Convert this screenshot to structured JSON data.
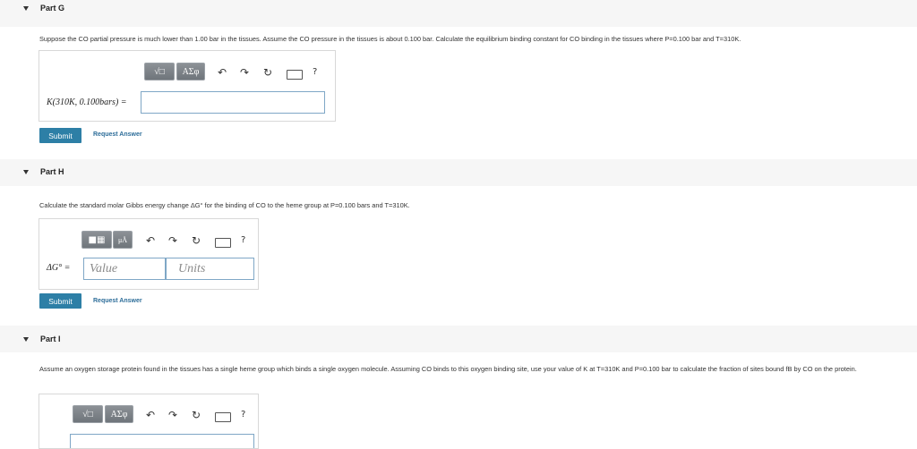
{
  "parts": {
    "g": {
      "title": "Part G",
      "question": "Suppose the CO  partial pressure is much lower than 1.00 bar in the tissues. Assume the CO pressure in the tissues is about 0.100 bar. Calculate the equilibrium binding constant for CO binding in the tissues where P=0.100 bar and T=310K.",
      "label": "K(310K, 0.100bars) =",
      "value": "",
      "submit": "Submit",
      "request": "Request Answer"
    },
    "h": {
      "title": "Part H",
      "question": "Calculate the standard molar Gibbs energy change ΔG° for the binding of CO to the heme group at P=0.100 bars and T=310K.",
      "label": "ΔG° =",
      "value_placeholder": "Value",
      "units_placeholder": "Units",
      "submit": "Submit",
      "request": "Request Answer"
    },
    "i": {
      "title": "Part I",
      "question": "Assume an oxygen storage protein found in the tissues has a single heme group which binds a single oxygen molecule. Assuming CO binds to this oxygen binding site, use your value of K at T=310K and P=0.100 bar to calculate the fraction of sites bound fB by CO on the protein."
    }
  },
  "toolbar": {
    "templates_glyph": "√□",
    "greek_label": "ΑΣφ",
    "units_glyph": "μÅ",
    "undo_glyph": "↶",
    "redo_glyph": "↷",
    "reset_glyph": "↻",
    "help_label": "?"
  }
}
